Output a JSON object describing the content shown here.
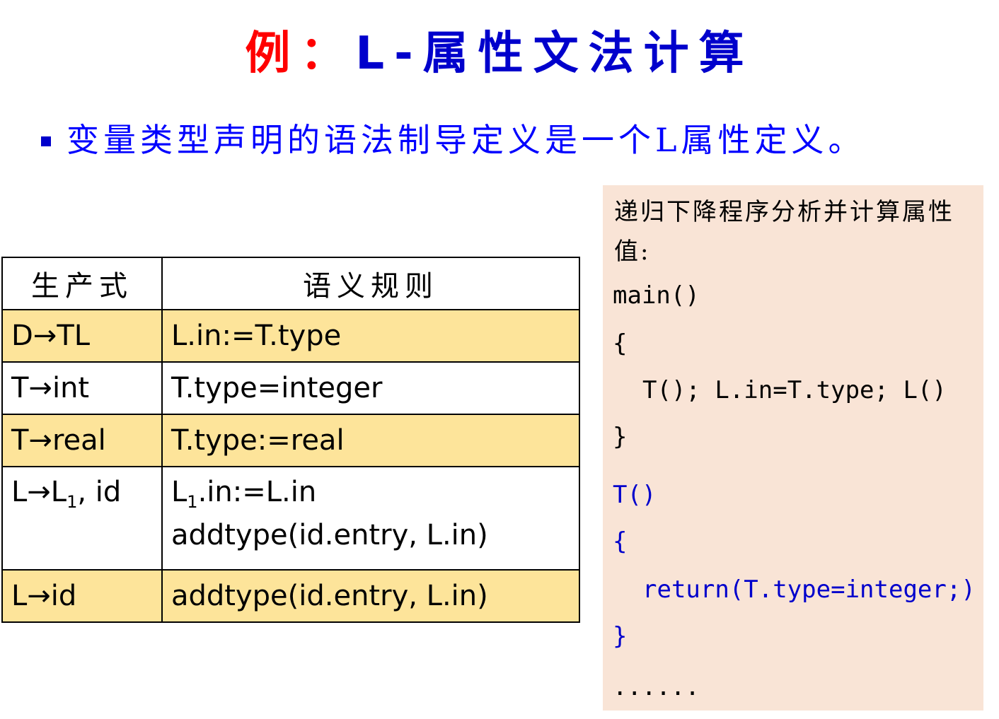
{
  "title": {
    "prefix": "例：",
    "main": "L-属性文法计算"
  },
  "bullet": {
    "text": "变量类型声明的语法制导定义是一个L属性定义。"
  },
  "table": {
    "headers": [
      "生产式",
      "语义规则"
    ],
    "rows": [
      {
        "production": "D→TL",
        "rule": "L.in:=T.type"
      },
      {
        "production": "T→int",
        "rule": "T.type=integer"
      },
      {
        "production": "T→real",
        "rule": "T.type:=real"
      },
      {
        "production_pre": "L→L",
        "production_sub": "1",
        "production_post": ", id",
        "rule_line1_pre": "L",
        "rule_line1_sub": "1",
        "rule_line1_post": ".in:=L.in",
        "rule_line2": "addtype(id.entry, L.in)"
      },
      {
        "production": "L→id",
        "rule": "addtype(id.entry, L.in)"
      }
    ]
  },
  "code": {
    "header": "递归下降程序分析并计算属性值:",
    "lines": [
      "main()",
      "{",
      "T(); L.in=T.type; L()",
      "}",
      "T()",
      "{",
      "return(T.type=integer;)",
      "}",
      "......"
    ]
  },
  "colors": {
    "title_prefix": "#ff0000",
    "title_main": "#0000cc",
    "bullet_text": "#0000ff",
    "row_highlight": "#fde49a",
    "code_bg": "#f9e4d6",
    "code_blue": "#0000cc"
  }
}
